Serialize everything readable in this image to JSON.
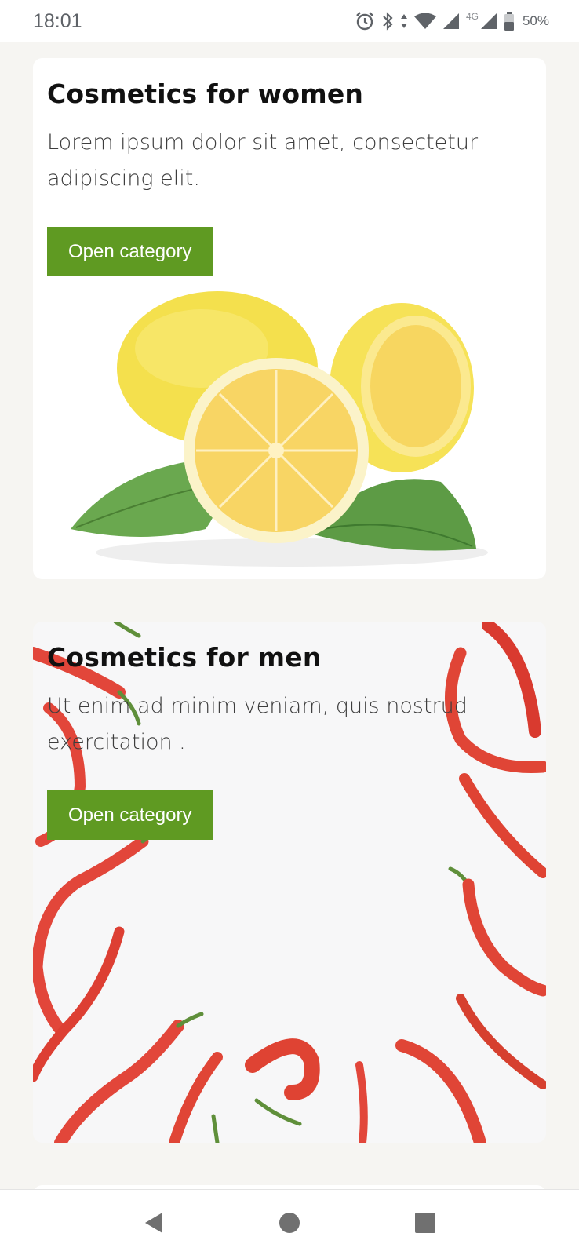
{
  "status_bar": {
    "time": "18:01",
    "network_label": "4G",
    "battery": "50%",
    "icons": [
      "alarm-icon",
      "bluetooth-icon",
      "data-arrows-icon",
      "wifi-icon",
      "signal-icon",
      "signal-4g-icon",
      "battery-icon"
    ]
  },
  "cards": [
    {
      "title": "Cosmetics for women",
      "description": "Lorem ipsum dolor sit amet, consectetur adipiscing elit.",
      "button": "Open category",
      "image": "lemons"
    },
    {
      "title": "Cosmetics for men",
      "description": "Ut enim ad minim veniam, quis nostrud exercitation .",
      "button": "Open category",
      "image": "chili-peppers"
    }
  ],
  "colors": {
    "accent": "#5f9a22",
    "background": "#f6f5f2",
    "card": "#ffffff"
  },
  "nav_bar": {
    "icons": [
      "back-icon",
      "home-icon",
      "recents-icon"
    ]
  }
}
